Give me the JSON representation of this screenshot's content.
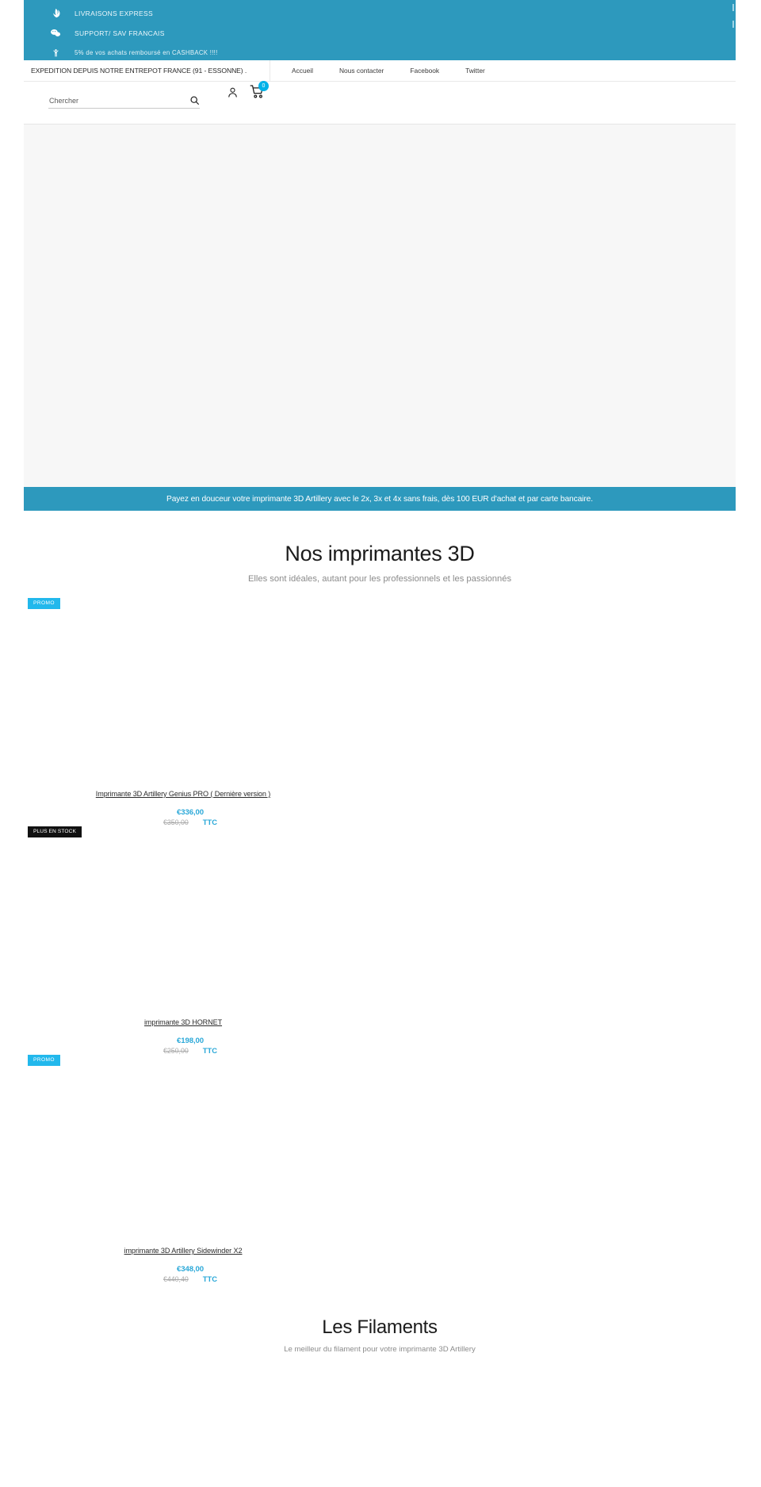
{
  "top_banner": {
    "features": [
      {
        "icon": "rebel-alliance-icon",
        "label": "LIVRAISONS EXPRESS"
      },
      {
        "icon": "chat-bubbles-icon",
        "label": "SUPPORT/ SAV FRANCAIS"
      },
      {
        "icon": "person-raised-arms-icon",
        "label": "5% de vos achats remboursé en CASHBACK !!!!"
      }
    ]
  },
  "nav": {
    "notice": "EXPEDITION DEPUIS NOTRE ENTREPOT FRANCE (91 - ESSONNE) .",
    "links": [
      {
        "label": "Accueil"
      },
      {
        "label": "Nous contacter"
      },
      {
        "label": "Facebook"
      },
      {
        "label": "Twitter"
      }
    ]
  },
  "header": {
    "search_placeholder": "Chercher",
    "search_value": "",
    "cart_count": "0"
  },
  "promo_bar": {
    "text": "Payez en douceur votre imprimante 3D Artillery avec le 2x, 3x et 4x sans frais, dès 100 EUR d'achat et par carte bancaire."
  },
  "printers_section": {
    "title": "Nos imprimantes 3D",
    "subtitle": "Elles sont idéales, autant pour les professionnels et les passionnés",
    "products": [
      {
        "badge": "PROMO",
        "badge_type": "promo",
        "title": "Imprimante 3D Artillery Genius PRO ( Dernière version )",
        "price_new": "€336,00",
        "price_old": "€350,00",
        "tax_label": "TTC"
      },
      {
        "badge": "PLUS EN STOCK",
        "badge_type": "oos",
        "title": "imprimante 3D HORNET",
        "price_new": "€198,00",
        "price_old": "€250,00",
        "tax_label": "TTC"
      },
      {
        "badge": "PROMO",
        "badge_type": "promo",
        "title": "imprimante 3D Artillery Sidewinder X2",
        "price_new": "€348,00",
        "price_old": "€440,40",
        "tax_label": "TTC"
      }
    ]
  },
  "filaments_section": {
    "title": "Les Filaments",
    "subtitle": "Le meilleur du filament pour votre imprimante 3D Artillery"
  },
  "colors": {
    "brand_teal": "#2d99bd",
    "accent_cyan": "#2aa8d8",
    "badge_cyan": "#22b8ec",
    "badge_black": "#111111"
  }
}
